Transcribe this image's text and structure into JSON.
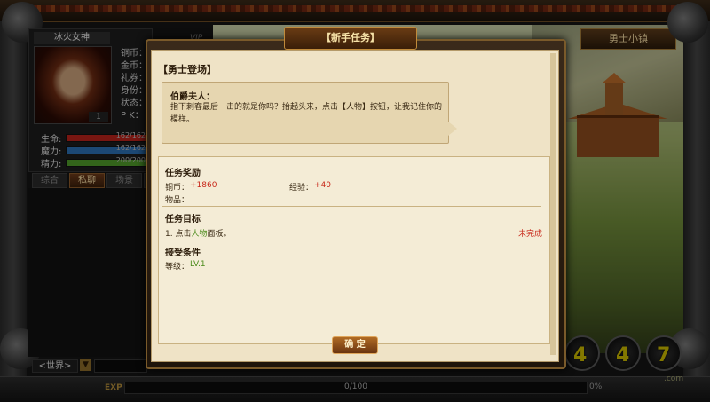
{
  "character": {
    "name": "冰火女神",
    "level": "1",
    "vip_label": "VIP",
    "stat_labels": [
      "铜币：",
      "金币：",
      "礼券：",
      "身份：",
      "状态：",
      "P K："
    ],
    "bars": [
      {
        "label": "生命:",
        "value": "162/162",
        "fraction": 1.0,
        "color": "#b8231b"
      },
      {
        "label": "魔力:",
        "value": "162/162",
        "fraction": 1.0,
        "color": "#2c6fb2"
      },
      {
        "label": "精力:",
        "value": "200/200",
        "fraction": 1.0,
        "color": "#4f9a2a"
      }
    ]
  },
  "chat": {
    "tabs": [
      "综合",
      "私聊",
      "场景",
      ""
    ],
    "active_tab": 1,
    "channel": "<世界>",
    "channel_arrow": "▼"
  },
  "scene": {
    "town_name": "勇士小镇"
  },
  "skills": {
    "numbers": [
      "4",
      "4",
      "7"
    ]
  },
  "site_tag": ".com",
  "exp": {
    "label": "EXP",
    "value": "0/100",
    "percent_text": "0%",
    "fraction": 0
  },
  "quest_dialog": {
    "title": "【新手任务】",
    "quest_name": "【勇士登场】",
    "speaker": "伯爵夫人：",
    "speech": "指下刺客最后一击的就是你吗？抬起头来，点击【人物】按钮，让我记住你的模样。",
    "rewards_title": "任务奖励",
    "copper_label": "铜币：",
    "copper_value": "+1860",
    "exp_label": "经验：",
    "exp_value": "+40",
    "items_label": "物品：",
    "objective_title": "任务目标",
    "objective_prefix": "1. 点击",
    "objective_link": "人物",
    "objective_suffix": "面板。",
    "objective_status": "未完成",
    "conditions_title": "接受条件",
    "level_label": "等级：",
    "level_value": "LV.1",
    "confirm_button": "确 定"
  },
  "colors": {
    "panel_bg": "#efe3c6",
    "accent_red": "#c8281a",
    "accent_green": "#4a8a1a",
    "gold": "#c9b800"
  }
}
